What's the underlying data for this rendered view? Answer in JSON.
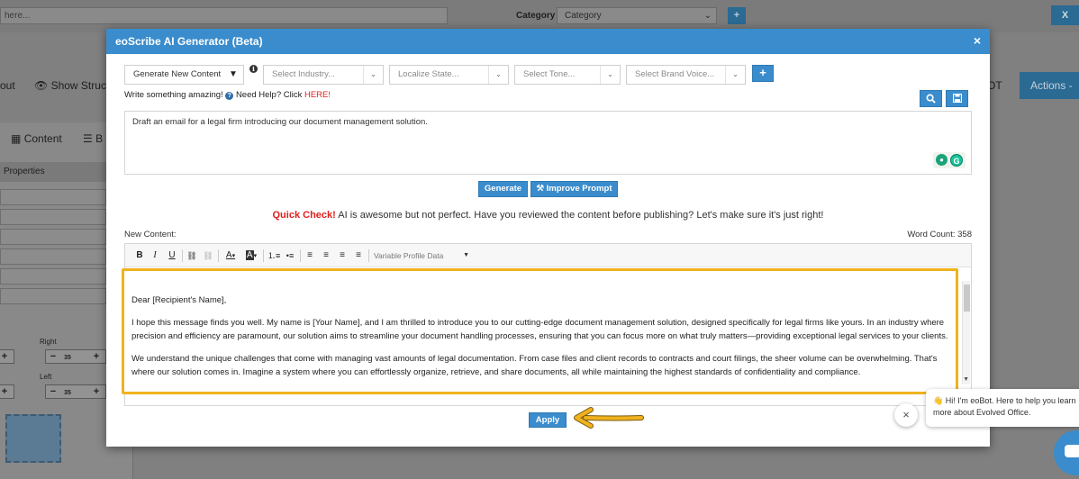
{
  "background": {
    "search_placeholder": "here...",
    "category_label": "Category",
    "category_value": "Category",
    "close_glyph": "X",
    "plus_glyph": "+",
    "out_label": "out",
    "show_structure_label": "Show Structu",
    "ot_label": "OT",
    "actions_label": "Actions -",
    "content_tab": "Content",
    "b_tab": "B",
    "properties_label": "Properties",
    "right_label": "Right",
    "left_label": "Left",
    "stepper_value": "35"
  },
  "modal": {
    "title": "eoScribe AI Generator (Beta)",
    "close_glyph": "×",
    "mode_select": "Generate New Content",
    "industry_select": "Select Industry...",
    "state_select": "Localize State...",
    "tone_select": "Select Tone...",
    "brand_voice_select": "Select Brand Voice...",
    "add_glyph": "+",
    "help_text_before": "Write something amazing!",
    "help_text_need": "Need Help? Click",
    "help_link": "HERE!",
    "prompt_text": "Draft an email for a legal firm introducing our document management solution.",
    "generate_button": "Generate",
    "improve_prompt_button": "Improve Prompt",
    "quick_check_label": "Quick Check!",
    "quick_check_text": "AI is awesome but not perfect. Have you reviewed the content before publishing? Let's make sure it's just right!",
    "new_content_label": "New Content:",
    "word_count_label": "Word Count:",
    "word_count_value": "358",
    "toolbar": {
      "bold": "B",
      "italic": "I",
      "underline": "U",
      "variable_profile_data": "Variable Profile Data"
    },
    "editor_paragraphs": [
      "Dear [Recipient's Name],",
      "I hope this message finds you well. My name is [Your Name], and I am thrilled to introduce you to our cutting-edge document management solution, designed specifically for legal firms like yours. In an industry where precision and efficiency are paramount, our solution aims to streamline your document handling processes, ensuring that you can focus more on what truly matters—providing exceptional legal services to your clients.",
      "We understand the unique challenges that come with managing vast amounts of legal documentation. From case files and client records to contracts and court filings, the sheer volume can be overwhelming. That's where our solution comes in. Imagine a system where you can effortlessly organize, retrieve, and share documents, all while maintaining the highest standards of confidentiality and compliance."
    ],
    "apply_button": "Apply"
  },
  "chat": {
    "close_glyph": "×",
    "message": "👋 Hi! I'm eoBot. Here to help you learn more about Evolved Office."
  },
  "colors": {
    "accent": "#3a8ccc",
    "highlight_border": "#f0b21e",
    "link_red": "#e02020"
  }
}
